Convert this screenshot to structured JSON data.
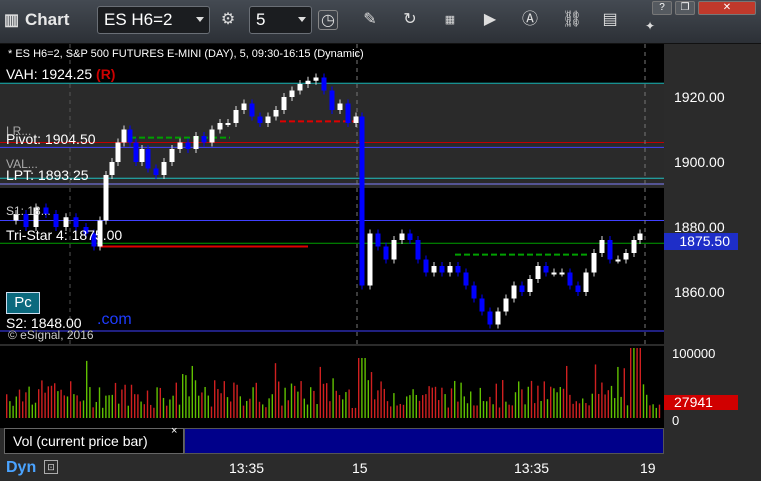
{
  "app": {
    "title": "Chart",
    "icon": "chart-app-icon"
  },
  "toolbar": {
    "symbol": "ES H6=2",
    "interval": "5",
    "icons": [
      "settings-gear-icon",
      "clock-icon",
      "pencil-icon",
      "refresh-icon",
      "calculator-icon",
      "play-icon",
      "text-a-icon",
      "link-icon",
      "chart-icon",
      "twitter-icon"
    ]
  },
  "window_buttons": {
    "help": "?",
    "restore": "❐",
    "close": "✕"
  },
  "header": {
    "info": "* ES H6=2, S&P 500 FUTURES E-MINI (DAY), 5, 09:30-16:15 (Dynamic)"
  },
  "levels": {
    "vah": "VAH: 1924.25",
    "vah_flag": "(R)",
    "pivot": "Pivot: 1904.50",
    "lpt": "LPT: 1893.25",
    "tri_star": "Tri-Star 4: 1875.00",
    "s2": "S2: 1848.00"
  },
  "overlaps": {
    "lr": "LR...",
    "val": "VAL...",
    "s1": "S1: 18..."
  },
  "price_axis": [
    "1920.00",
    "1900.00",
    "1880.00",
    "1860.00"
  ],
  "current_price": "1875.50",
  "pc_button": "Pc",
  "com_text": ".com",
  "copyright": "© eSignal, 2016",
  "volume": {
    "label": "Vol (current price bar)",
    "close": "×",
    "axis_top": "100000",
    "axis_bottom": "0",
    "current": "27941"
  },
  "bottom": {
    "dyn": "Dyn",
    "times": [
      "13:35",
      "15",
      "13:35",
      "19"
    ]
  },
  "colors": {
    "up": "#ffffff",
    "down": "#0000ff",
    "vah_line": "#20c0c0",
    "pivot_line": "#c00000",
    "tri_star": "#00a000",
    "accent_blue": "#1e2ec8",
    "red_badge": "#d00000"
  }
}
